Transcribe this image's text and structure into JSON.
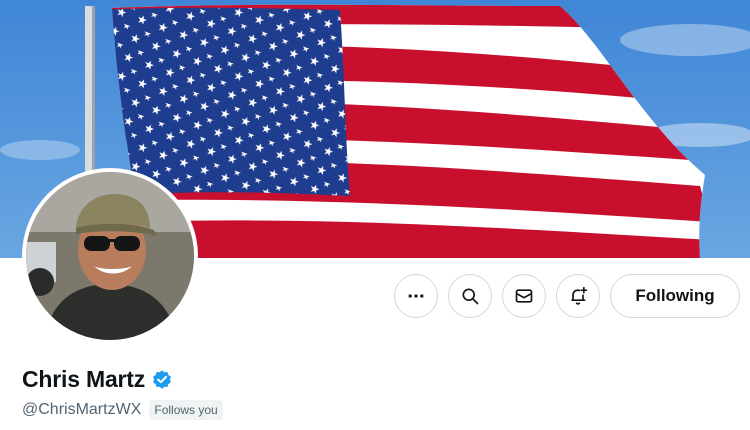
{
  "profile": {
    "display_name": "Chris Martz",
    "handle": "@ChrisMartzWX",
    "follows_you_badge": "Follows you",
    "verified": true
  },
  "actions": {
    "more_icon": "more-icon",
    "search_icon": "search-icon",
    "message_icon": "envelope-icon",
    "notify_icon": "bell-plus-icon",
    "following_label": "Following"
  },
  "colors": {
    "verified_blue": "#1d9bf0",
    "text_primary": "#0f1419",
    "text_secondary": "#536471",
    "border": "#cfd9de"
  }
}
